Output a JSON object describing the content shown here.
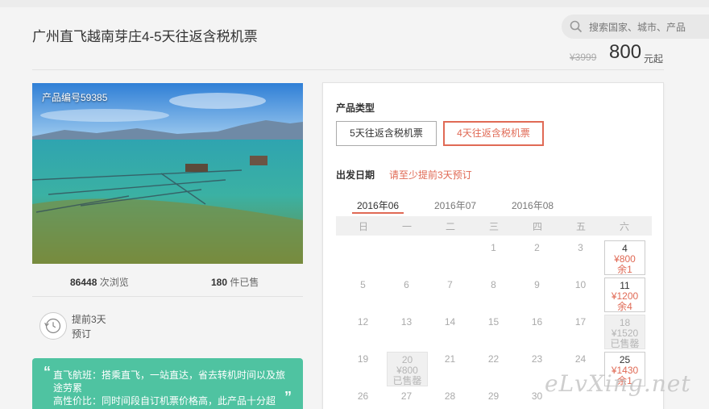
{
  "header": {
    "title": "广州直飞越南芽庄4-5天往返含税机票",
    "search_placeholder": "搜索国家、城市、产品",
    "price_old": "¥3999",
    "price_now": "800",
    "price_unit": "元起"
  },
  "product": {
    "code_label": "产品编号59385",
    "views_value": "86448",
    "views_label": "次浏览",
    "sold_value": "180",
    "sold_label": "件已售",
    "advance_line1": "提前3天",
    "advance_line2": "预订",
    "feature1": "直飞航班：搭乘直飞，一站直达，省去转机时间以及旅途劳累",
    "feature2": "高性价比：同时间段自订机票价格高，此产品十分超"
  },
  "booking": {
    "type_label": "产品类型",
    "options": [
      "5天往返含税机票",
      "4天往返含税机票"
    ],
    "date_label": "出发日期",
    "date_hint": "请至少提前3天预订",
    "months": [
      "2016年06",
      "2016年07",
      "2016年08"
    ],
    "weekdays": [
      "日",
      "一",
      "二",
      "三",
      "四",
      "五",
      "六"
    ],
    "days": {
      "d1": "1",
      "d2": "2",
      "d3": "3",
      "d4": "4",
      "d5": "5",
      "d6": "6",
      "d7": "7",
      "d8": "8",
      "d9": "9",
      "d10": "10",
      "d11": "11",
      "d12": "12",
      "d13": "13",
      "d14": "14",
      "d15": "15",
      "d16": "16",
      "d17": "17",
      "d18": "18",
      "d19": "19",
      "d20": "20",
      "d21": "21",
      "d22": "22",
      "d23": "23",
      "d24": "24",
      "d25": "25",
      "d26": "26",
      "d27": "27",
      "d28": "28",
      "d29": "29",
      "d30": "30"
    },
    "slots": {
      "s4": {
        "price": "¥800",
        "status": "余1"
      },
      "s11": {
        "price": "¥1200",
        "status": "余4"
      },
      "s18": {
        "price": "¥1520",
        "status": "已售罄"
      },
      "s20": {
        "price": "¥800",
        "status": "已售罄"
      },
      "s25": {
        "price": "¥1430",
        "status": "余1"
      }
    }
  },
  "watermark": "eLvXing.net",
  "colors": {
    "accent": "#e06a55",
    "feature_bg": "#4fc3a1"
  }
}
